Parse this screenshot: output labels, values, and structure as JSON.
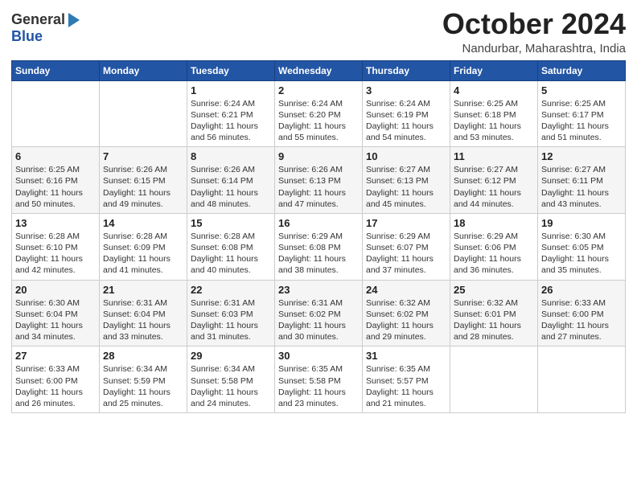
{
  "logo": {
    "general": "General",
    "blue": "Blue"
  },
  "header": {
    "month": "October 2024",
    "location": "Nandurbar, Maharashtra, India"
  },
  "weekdays": [
    "Sunday",
    "Monday",
    "Tuesday",
    "Wednesday",
    "Thursday",
    "Friday",
    "Saturday"
  ],
  "weeks": [
    [
      {
        "day": "",
        "info": ""
      },
      {
        "day": "",
        "info": ""
      },
      {
        "day": "1",
        "info": "Sunrise: 6:24 AM\nSunset: 6:21 PM\nDaylight: 11 hours and 56 minutes."
      },
      {
        "day": "2",
        "info": "Sunrise: 6:24 AM\nSunset: 6:20 PM\nDaylight: 11 hours and 55 minutes."
      },
      {
        "day": "3",
        "info": "Sunrise: 6:24 AM\nSunset: 6:19 PM\nDaylight: 11 hours and 54 minutes."
      },
      {
        "day": "4",
        "info": "Sunrise: 6:25 AM\nSunset: 6:18 PM\nDaylight: 11 hours and 53 minutes."
      },
      {
        "day": "5",
        "info": "Sunrise: 6:25 AM\nSunset: 6:17 PM\nDaylight: 11 hours and 51 minutes."
      }
    ],
    [
      {
        "day": "6",
        "info": "Sunrise: 6:25 AM\nSunset: 6:16 PM\nDaylight: 11 hours and 50 minutes."
      },
      {
        "day": "7",
        "info": "Sunrise: 6:26 AM\nSunset: 6:15 PM\nDaylight: 11 hours and 49 minutes."
      },
      {
        "day": "8",
        "info": "Sunrise: 6:26 AM\nSunset: 6:14 PM\nDaylight: 11 hours and 48 minutes."
      },
      {
        "day": "9",
        "info": "Sunrise: 6:26 AM\nSunset: 6:13 PM\nDaylight: 11 hours and 47 minutes."
      },
      {
        "day": "10",
        "info": "Sunrise: 6:27 AM\nSunset: 6:13 PM\nDaylight: 11 hours and 45 minutes."
      },
      {
        "day": "11",
        "info": "Sunrise: 6:27 AM\nSunset: 6:12 PM\nDaylight: 11 hours and 44 minutes."
      },
      {
        "day": "12",
        "info": "Sunrise: 6:27 AM\nSunset: 6:11 PM\nDaylight: 11 hours and 43 minutes."
      }
    ],
    [
      {
        "day": "13",
        "info": "Sunrise: 6:28 AM\nSunset: 6:10 PM\nDaylight: 11 hours and 42 minutes."
      },
      {
        "day": "14",
        "info": "Sunrise: 6:28 AM\nSunset: 6:09 PM\nDaylight: 11 hours and 41 minutes."
      },
      {
        "day": "15",
        "info": "Sunrise: 6:28 AM\nSunset: 6:08 PM\nDaylight: 11 hours and 40 minutes."
      },
      {
        "day": "16",
        "info": "Sunrise: 6:29 AM\nSunset: 6:08 PM\nDaylight: 11 hours and 38 minutes."
      },
      {
        "day": "17",
        "info": "Sunrise: 6:29 AM\nSunset: 6:07 PM\nDaylight: 11 hours and 37 minutes."
      },
      {
        "day": "18",
        "info": "Sunrise: 6:29 AM\nSunset: 6:06 PM\nDaylight: 11 hours and 36 minutes."
      },
      {
        "day": "19",
        "info": "Sunrise: 6:30 AM\nSunset: 6:05 PM\nDaylight: 11 hours and 35 minutes."
      }
    ],
    [
      {
        "day": "20",
        "info": "Sunrise: 6:30 AM\nSunset: 6:04 PM\nDaylight: 11 hours and 34 minutes."
      },
      {
        "day": "21",
        "info": "Sunrise: 6:31 AM\nSunset: 6:04 PM\nDaylight: 11 hours and 33 minutes."
      },
      {
        "day": "22",
        "info": "Sunrise: 6:31 AM\nSunset: 6:03 PM\nDaylight: 11 hours and 31 minutes."
      },
      {
        "day": "23",
        "info": "Sunrise: 6:31 AM\nSunset: 6:02 PM\nDaylight: 11 hours and 30 minutes."
      },
      {
        "day": "24",
        "info": "Sunrise: 6:32 AM\nSunset: 6:02 PM\nDaylight: 11 hours and 29 minutes."
      },
      {
        "day": "25",
        "info": "Sunrise: 6:32 AM\nSunset: 6:01 PM\nDaylight: 11 hours and 28 minutes."
      },
      {
        "day": "26",
        "info": "Sunrise: 6:33 AM\nSunset: 6:00 PM\nDaylight: 11 hours and 27 minutes."
      }
    ],
    [
      {
        "day": "27",
        "info": "Sunrise: 6:33 AM\nSunset: 6:00 PM\nDaylight: 11 hours and 26 minutes."
      },
      {
        "day": "28",
        "info": "Sunrise: 6:34 AM\nSunset: 5:59 PM\nDaylight: 11 hours and 25 minutes."
      },
      {
        "day": "29",
        "info": "Sunrise: 6:34 AM\nSunset: 5:58 PM\nDaylight: 11 hours and 24 minutes."
      },
      {
        "day": "30",
        "info": "Sunrise: 6:35 AM\nSunset: 5:58 PM\nDaylight: 11 hours and 23 minutes."
      },
      {
        "day": "31",
        "info": "Sunrise: 6:35 AM\nSunset: 5:57 PM\nDaylight: 11 hours and 21 minutes."
      },
      {
        "day": "",
        "info": ""
      },
      {
        "day": "",
        "info": ""
      }
    ]
  ]
}
